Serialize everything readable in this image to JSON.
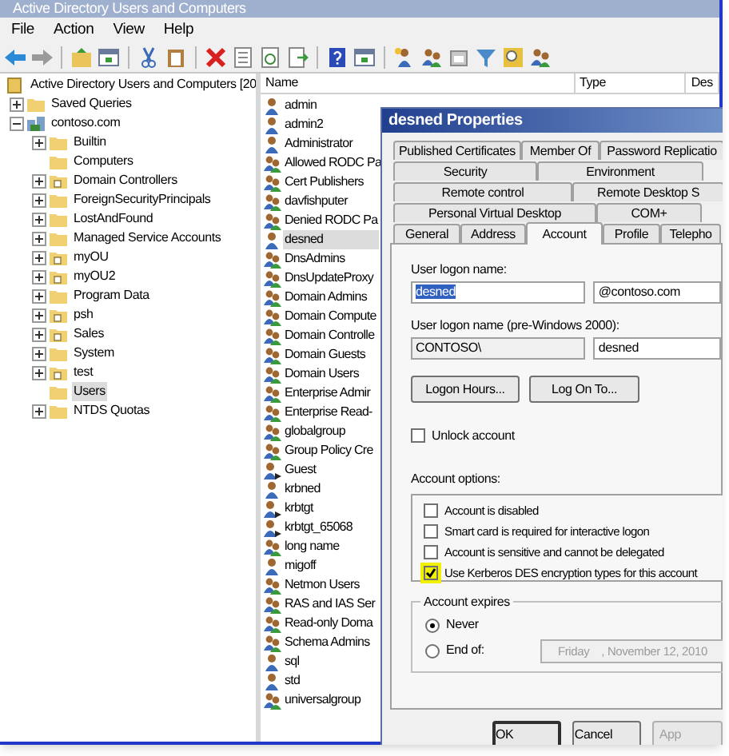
{
  "window": {
    "title": "Active Directory Users and Computers"
  },
  "menu": [
    "File",
    "Action",
    "View",
    "Help"
  ],
  "tree": {
    "label": "Active Directory Users and Computers [20",
    "kind": "root",
    "selected": false,
    "children": [
      {
        "label": "Saved Queries",
        "kind": "folder",
        "expanded": false,
        "selected": false
      },
      {
        "label": "contoso.com",
        "kind": "domain",
        "expanded": true,
        "selected": false,
        "children": [
          {
            "label": "Builtin",
            "kind": "folder",
            "expanded": false,
            "selected": false
          },
          {
            "label": "Computers",
            "kind": "folder",
            "selected": false
          },
          {
            "label": "Domain Controllers",
            "kind": "ou",
            "expanded": false,
            "selected": false
          },
          {
            "label": "ForeignSecurityPrincipals",
            "kind": "folder",
            "expanded": false,
            "selected": false
          },
          {
            "label": "LostAndFound",
            "kind": "folder",
            "expanded": false,
            "selected": false
          },
          {
            "label": "Managed Service Accounts",
            "kind": "folder",
            "expanded": false,
            "selected": false
          },
          {
            "label": "myOU",
            "kind": "ou",
            "expanded": false,
            "selected": false
          },
          {
            "label": "myOU2",
            "kind": "ou",
            "expanded": false,
            "selected": false
          },
          {
            "label": "Program Data",
            "kind": "folder",
            "expanded": false,
            "selected": false
          },
          {
            "label": "psh",
            "kind": "ou",
            "expanded": false,
            "selected": false
          },
          {
            "label": "Sales",
            "kind": "ou",
            "expanded": false,
            "selected": false
          },
          {
            "label": "System",
            "kind": "folder",
            "expanded": false,
            "selected": false
          },
          {
            "label": "test",
            "kind": "ou",
            "expanded": false,
            "selected": false
          },
          {
            "label": "Users",
            "kind": "folder",
            "selected": true
          },
          {
            "label": "NTDS Quotas",
            "kind": "folder",
            "expanded": false,
            "selected": false
          }
        ]
      }
    ]
  },
  "list": {
    "columns": [
      "Name",
      "Type",
      "Des"
    ],
    "rows": [
      {
        "name": "admin",
        "kind": "user",
        "selected": false
      },
      {
        "name": "admin2",
        "kind": "user",
        "selected": false
      },
      {
        "name": "Administrator",
        "kind": "user",
        "selected": false
      },
      {
        "name": "Allowed RODC Pa",
        "kind": "group",
        "selected": false
      },
      {
        "name": "Cert Publishers",
        "kind": "group",
        "selected": false
      },
      {
        "name": "davfishputer",
        "kind": "group",
        "selected": false
      },
      {
        "name": "Denied RODC Pa",
        "kind": "group",
        "selected": false
      },
      {
        "name": "desned",
        "kind": "user",
        "selected": true
      },
      {
        "name": "DnsAdmins",
        "kind": "group",
        "selected": false
      },
      {
        "name": "DnsUpdateProxy",
        "kind": "group",
        "selected": false
      },
      {
        "name": "Domain Admins",
        "kind": "group",
        "selected": false
      },
      {
        "name": "Domain Compute",
        "kind": "group",
        "selected": false
      },
      {
        "name": "Domain Controlle",
        "kind": "group",
        "selected": false
      },
      {
        "name": "Domain Guests",
        "kind": "group",
        "selected": false
      },
      {
        "name": "Domain Users",
        "kind": "group",
        "selected": false
      },
      {
        "name": "Enterprise Admir",
        "kind": "group",
        "selected": false
      },
      {
        "name": "Enterprise Read-",
        "kind": "group",
        "selected": false
      },
      {
        "name": "globalgroup",
        "kind": "group",
        "selected": false
      },
      {
        "name": "Group Policy Cre",
        "kind": "group",
        "selected": false
      },
      {
        "name": "Guest",
        "kind": "user-disabled",
        "selected": false
      },
      {
        "name": "krbned",
        "kind": "user",
        "selected": false
      },
      {
        "name": "krbtgt",
        "kind": "user-disabled",
        "selected": false
      },
      {
        "name": "krbtgt_65068",
        "kind": "user-disabled",
        "selected": false
      },
      {
        "name": "long name",
        "kind": "group",
        "selected": false
      },
      {
        "name": "migoff",
        "kind": "user",
        "selected": false
      },
      {
        "name": "Netmon Users",
        "kind": "group",
        "selected": false
      },
      {
        "name": "RAS and IAS Ser",
        "kind": "group",
        "selected": false
      },
      {
        "name": "Read-only Doma",
        "kind": "group",
        "selected": false
      },
      {
        "name": "Schema Admins",
        "kind": "group",
        "selected": false
      },
      {
        "name": "sql",
        "kind": "user",
        "selected": false
      },
      {
        "name": "std",
        "kind": "user",
        "selected": false
      },
      {
        "name": "universalgroup",
        "kind": "group",
        "selected": false
      }
    ]
  },
  "dialog": {
    "title": "desned Properties",
    "tab_rows": [
      [
        {
          "label": "Published Certificates",
          "selected": false
        },
        {
          "label": "Member Of",
          "selected": false
        },
        {
          "label": "Password Replicatio",
          "selected": false
        }
      ],
      [
        {
          "label": "Security",
          "selected": false
        },
        {
          "label": "Environment",
          "selected": false
        }
      ],
      [
        {
          "label": "Remote control",
          "selected": false
        },
        {
          "label": "Remote Desktop S",
          "selected": false
        }
      ],
      [
        {
          "label": "Personal Virtual Desktop",
          "selected": false
        },
        {
          "label": "COM+",
          "selected": false
        }
      ],
      [
        {
          "label": "General",
          "selected": false
        },
        {
          "label": "Address",
          "selected": false
        },
        {
          "label": "Account",
          "selected": true
        },
        {
          "label": "Profile",
          "selected": false
        },
        {
          "label": "Telepho",
          "selected": false
        }
      ]
    ],
    "logon_name_label": "User logon name:",
    "logon_name": "desned",
    "logon_domain": "@contoso.com",
    "pre2000_label": "User logon name (pre-Windows 2000):",
    "pre2000_domain": "CONTOSO\\",
    "pre2000_name": "desned",
    "buttons": [
      "Logon Hours...",
      "Log On To..."
    ],
    "unlock": {
      "label": "Unlock account",
      "checked": false
    },
    "options_label": "Account options:",
    "options": [
      {
        "label": "Account is disabled",
        "checked": false
      },
      {
        "label": "Smart card is required for interactive logon",
        "checked": false
      },
      {
        "label": "Account is sensitive and cannot be delegated",
        "checked": false
      },
      {
        "label": "Use Kerberos DES encryption types for this account",
        "checked": true
      }
    ],
    "expires": {
      "label": "Account expires",
      "choices": [
        {
          "label": "Never",
          "selected": true
        },
        {
          "label": "End of:",
          "selected": false
        }
      ],
      "date": "Friday    , November 12, 2010"
    },
    "footer": [
      "OK",
      "Cancel",
      "App"
    ]
  }
}
